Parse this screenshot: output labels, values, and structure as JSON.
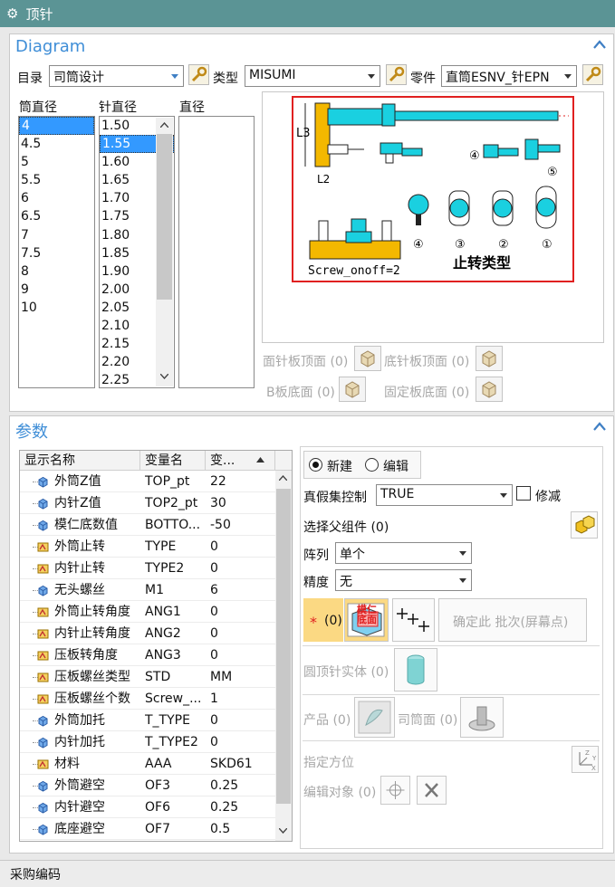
{
  "window": {
    "title": "顶针"
  },
  "diagram": {
    "title": "Diagram",
    "catalog_label": "目录",
    "catalog_value": "司筒设计",
    "type_label": "类型",
    "type_value": "MISUMI",
    "part_label": "零件",
    "part_value": "直筒ESNV_针EPN",
    "col1_header": "筒直径",
    "col2_header": "针直径",
    "col3_header": "直径",
    "col1_items": [
      "4",
      "4.5",
      "5",
      "5.5",
      "6",
      "6.5",
      "7",
      "7.5",
      "8",
      "9",
      "10"
    ],
    "col1_selected": 0,
    "col2_items": [
      "1.50",
      "1.55",
      "1.60",
      "1.65",
      "1.70",
      "1.75",
      "1.80",
      "1.85",
      "1.90",
      "2.00",
      "2.05",
      "2.10",
      "2.15",
      "2.20",
      "2.25"
    ],
    "col2_selected": 1,
    "image": {
      "l3": "L3",
      "l2": "L2",
      "screw": "Screw_onoff=2",
      "rotation_type": "止转类型",
      "n1": "①",
      "n2": "②",
      "n3": "③",
      "n4": "④",
      "n5": "⑤"
    },
    "face_top": "面针板顶面 (0)",
    "face_bottom": "底针板顶面 (0)",
    "b_plate_bottom": "B板底面 (0)",
    "fixed_plate_bottom": "固定板底面 (0)"
  },
  "params": {
    "title": "参数",
    "grid_headers": [
      "显示名称",
      "变量名",
      "变..."
    ],
    "rows": [
      {
        "name": "外筒Z值",
        "var": "TOP_pt",
        "val": "22",
        "icon": "blue"
      },
      {
        "name": "内针Z值",
        "var": "TOP2_pt",
        "val": "30",
        "icon": "blue"
      },
      {
        "name": "模仁底数值",
        "var": "BOTTO...",
        "val": "-50",
        "icon": "blue"
      },
      {
        "name": "外筒止转",
        "var": "TYPE",
        "val": "0",
        "icon": "yellow"
      },
      {
        "name": "内针止转",
        "var": "TYPE2",
        "val": "0",
        "icon": "yellow"
      },
      {
        "name": "无头螺丝",
        "var": "M1",
        "val": "6",
        "icon": "blue"
      },
      {
        "name": "外筒止转角度",
        "var": "ANG1",
        "val": "0",
        "icon": "yellow"
      },
      {
        "name": "内针止转角度",
        "var": "ANG2",
        "val": "0",
        "icon": "yellow"
      },
      {
        "name": "压板转角度",
        "var": "ANG3",
        "val": "0",
        "icon": "yellow"
      },
      {
        "name": "压板螺丝类型",
        "var": "STD",
        "val": "MM",
        "icon": "yellow"
      },
      {
        "name": "压板螺丝个数",
        "var": "Screw_...",
        "val": "1",
        "icon": "yellow"
      },
      {
        "name": "外筒加托",
        "var": "T_TYPE",
        "val": "0",
        "icon": "blue"
      },
      {
        "name": "内针加托",
        "var": "T_TYPE2",
        "val": "0",
        "icon": "blue"
      },
      {
        "name": "材料",
        "var": "AAA",
        "val": "SKD61",
        "icon": "yellow"
      },
      {
        "name": "外筒避空",
        "var": "OF3",
        "val": "0.25",
        "icon": "blue"
      },
      {
        "name": "内针避空",
        "var": "OF6",
        "val": "0.25",
        "icon": "blue"
      },
      {
        "name": "底座避空",
        "var": "OF7",
        "val": "0.5",
        "icon": "blue"
      }
    ],
    "mode_new": "新建",
    "mode_edit": "编辑",
    "truefalse_label": "真假集控制",
    "truefalse_value": "TRUE",
    "trim_label": "修减",
    "select_parent": "选择父组件 (0)",
    "array_label": "阵列",
    "array_value": "单个",
    "precision_label": "精度",
    "precision_value": "无",
    "star": "*",
    "point_count": "(0)",
    "mold_icon_text": "模仁底面",
    "confirm_label": "确定此 批次(屏幕点)",
    "round_pin_body": "圆顶针实体 (0)",
    "product": "产品 (0)",
    "sleeve_face": "司筒面 (0)",
    "orientation": "指定方位",
    "edit_object": "编辑对象 (0)"
  },
  "footer": {
    "label": "采购编码"
  },
  "colors": {
    "titlebar": "#5b9495",
    "accent": "#3f8ed7",
    "selection": "#3399ff",
    "cyan": "#1ad0e0",
    "gold": "#f3b800",
    "red": "#e02020"
  }
}
